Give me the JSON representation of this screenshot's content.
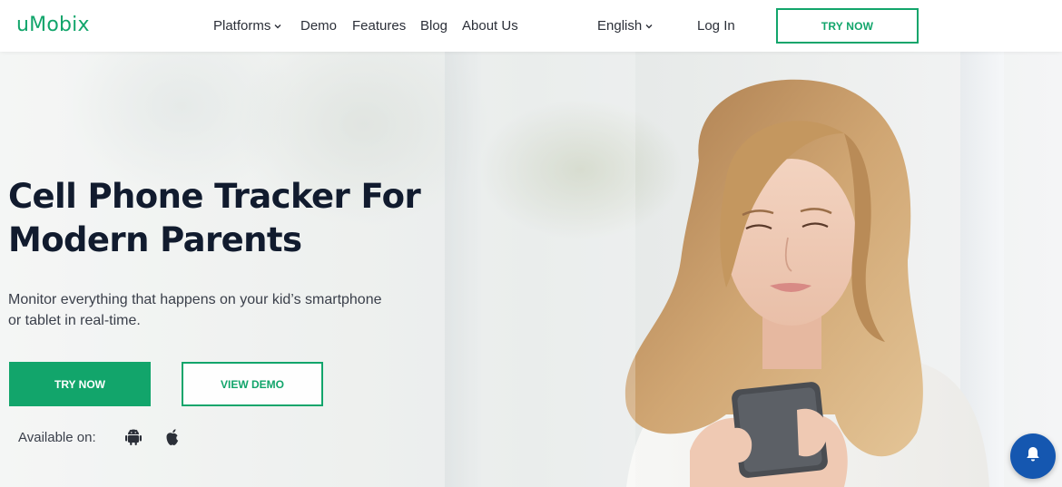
{
  "header": {
    "logo": "uMobix",
    "nav": [
      {
        "label": "Platforms",
        "has_caret": true
      },
      {
        "label": "Demo"
      },
      {
        "label": "Features"
      },
      {
        "label": "Blog"
      },
      {
        "label": "About Us"
      }
    ],
    "language": "English",
    "login": "Log In",
    "try_now": "TRY NOW"
  },
  "hero": {
    "title_line1": "Cell Phone Tracker For",
    "title_line2": "Modern Parents",
    "subtitle_line1": "Monitor everything that happens on your kid’s smartphone",
    "subtitle_line2": "or tablet in real-time.",
    "try_now": "TRY NOW",
    "view_demo": "VIEW DEMO",
    "available_on": "Available on:",
    "platforms": [
      "android-icon",
      "apple-icon"
    ]
  },
  "widgets": {
    "notification_icon": "bell-icon"
  },
  "colors": {
    "brand_green": "#12a56b",
    "heading_dark": "#111b2e",
    "bell_blue": "#1557b0"
  }
}
